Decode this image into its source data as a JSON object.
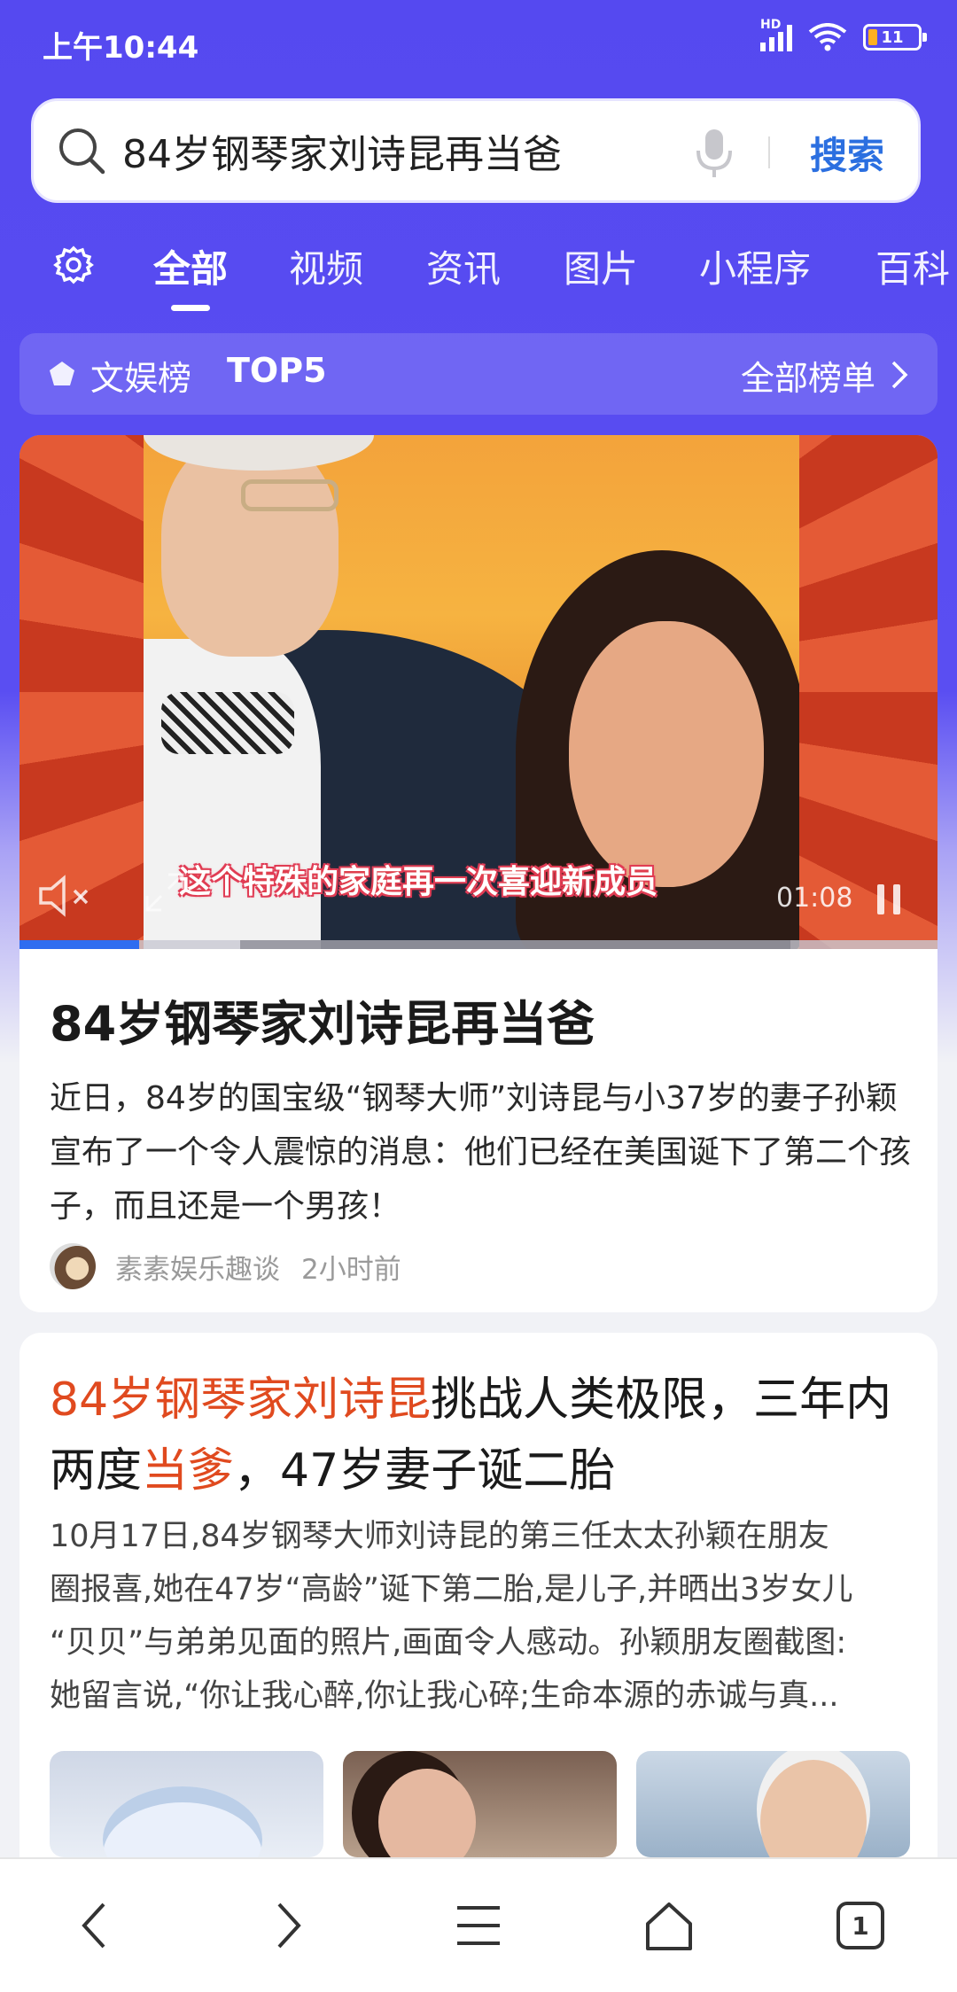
{
  "status": {
    "time": "上午10:44",
    "battery": "11",
    "network": "HD"
  },
  "search": {
    "query": "84岁钢琴家刘诗昆再当爸",
    "button": "搜索"
  },
  "tabs": [
    "全部",
    "视频",
    "资讯",
    "图片",
    "小程序",
    "百科"
  ],
  "rank": {
    "label": "文娱榜",
    "top": "TOP5",
    "all": "全部榜单"
  },
  "video": {
    "subtitle": "这个特殊的家庭再一次喜迎新成员",
    "duration": "01:08",
    "progress": 0.13,
    "buffered_from": 0.24,
    "buffered_to": 0.84
  },
  "card1": {
    "title": "84岁钢琴家刘诗昆再当爸",
    "summary": "近日，84岁的国宝级“钢琴大师”刘诗昆与小37岁的妻子孙颖宣布了一个令人震惊的消息：他们已经在美国诞下了第二个孩子，而且还是一个男孩！",
    "source": "素素娱乐趣谈",
    "time": "2小时前"
  },
  "card2": {
    "title_hl1": "84岁钢琴家刘诗昆",
    "title_part2": "挑战人类极限，三年内两度",
    "title_hl2": "当爹",
    "title_part3": "，47岁妻子诞二胎",
    "summary_lines": [
      "10月17日,84岁钢琴大师刘诗昆的第三任太太孙颖在朋友",
      "圈报喜,她在47岁“高龄”诞下第二胎,是儿子,并晒出3岁女儿",
      "“贝贝”与弟弟见面的照片,画面令人感动。孙颖朋友圈截图:",
      "她留言说,“你让我心醉,你让我心碎;生命本源的赤诚与真..."
    ]
  },
  "nav": {
    "tab_count": "1"
  },
  "colors": {
    "header": "#5549f0",
    "accent": "#2b6fe0",
    "highlight": "#e04a1f",
    "progress": "#2f6df0"
  }
}
